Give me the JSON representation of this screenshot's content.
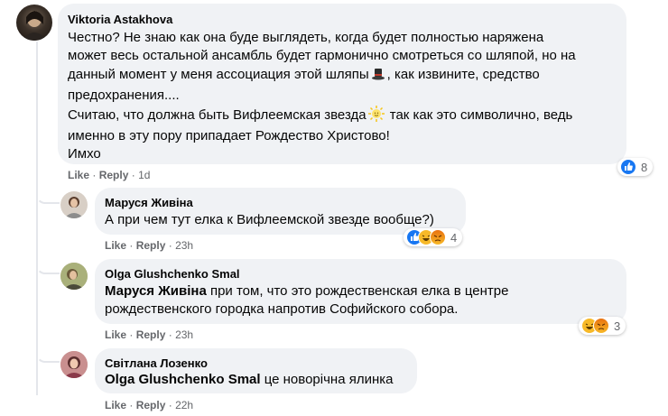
{
  "comments": [
    {
      "author": "Viktoria Astakhova",
      "lines": [
        "Честно? Не знаю как она буде выглядеть, когда будет полностью наряжена",
        "может весь остальной ансамбль будет гармонично смотреться со шляпой, но на",
        "данный момент у меня ассоциация этой шляпы",
        ", как извините, средство",
        "предохранения....",
        "Считаю, что должна быть Вифлеемская звезда",
        " так как это символично, ведь",
        "именно в эту пору припадает Рождество Христово!",
        "Имхо"
      ],
      "hat_emoji": "top-hat-emoji",
      "star_emoji": "sun-face-emoji",
      "like": "Like",
      "reply": "Reply",
      "time": "1d",
      "reaction_count": "8"
    },
    {
      "author": "Маруся Живіна",
      "lines": [
        "А при чем тут елка к Вифлеемской звезде вообще?)"
      ],
      "like": "Like",
      "reply": "Reply",
      "time": "23h",
      "reaction_count": "4"
    },
    {
      "author": "Olga Glushchenko Smal",
      "tag": "Маруся Живіна",
      "lines": [
        " при том, что это рождественская елка в центре",
        "рождественского городка напротив Софийского собора."
      ],
      "like": "Like",
      "reply": "Reply",
      "time": "23h",
      "reaction_count": "3"
    },
    {
      "author": "Світлана Лозенко",
      "tag": "Olga Glushchenko Smal",
      "lines": [
        " це новорічна ялинка"
      ],
      "like": "Like",
      "reply": "Reply",
      "time": "22h"
    }
  ],
  "separator": "·",
  "colors": {
    "bubble": "#f0f2f5",
    "meta": "#65676b",
    "like_blue": "#1877f2",
    "haha_yellow": "#f7b928",
    "angry_orange": "#e9710f"
  }
}
